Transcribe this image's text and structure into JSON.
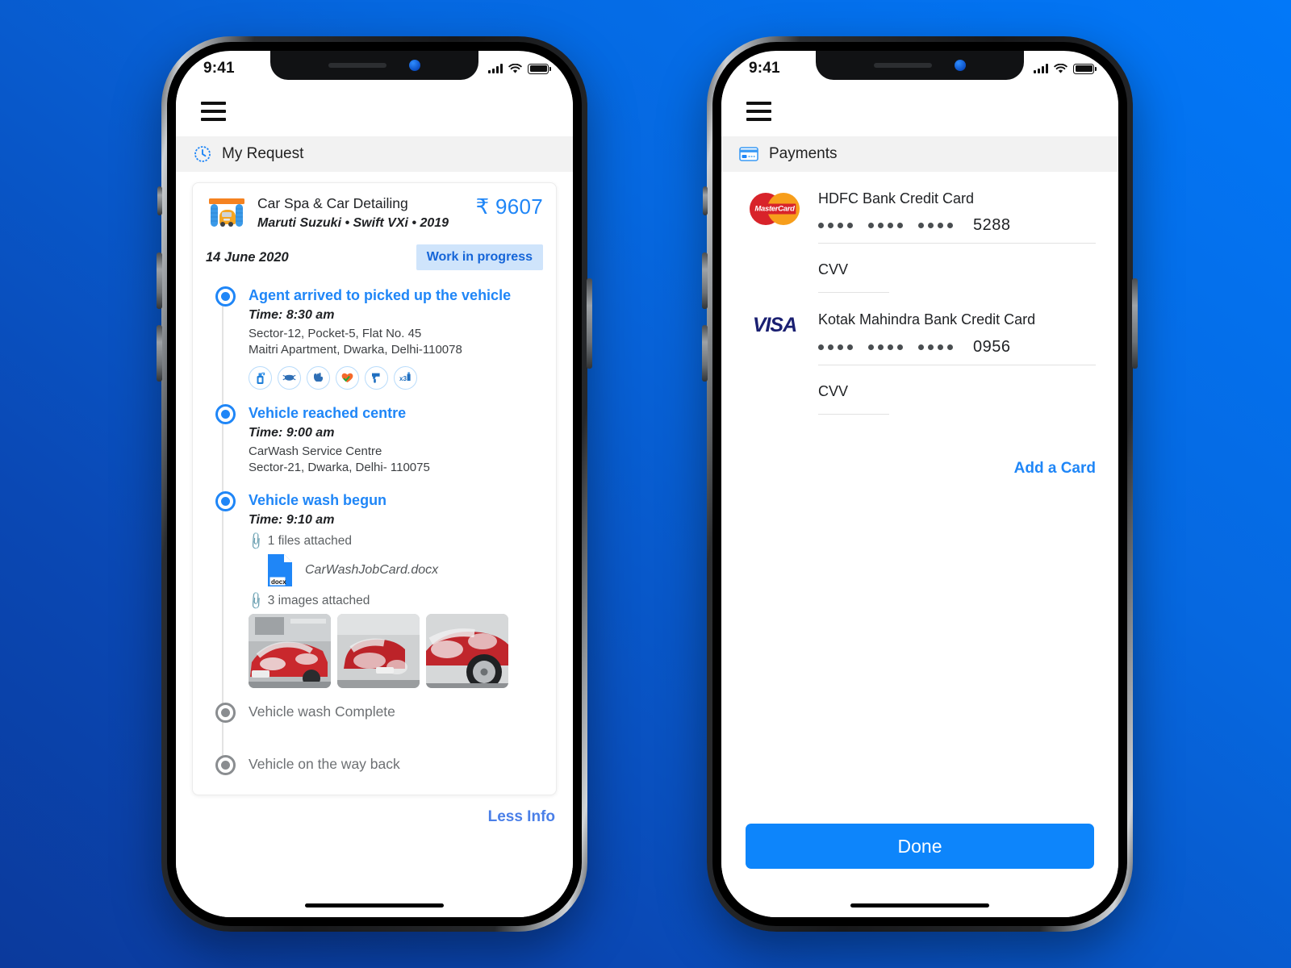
{
  "background": {
    "from": "#0278f8",
    "to": "#0b3a9c"
  },
  "accent": "#1f86f7",
  "phones": {
    "left": {
      "status": {
        "time": "9:41"
      },
      "nav": {
        "menu_icon": "hamburger-icon"
      },
      "section": {
        "icon": "clock-icon",
        "title": "My Request"
      },
      "card": {
        "service_icon": "car-wash-icon",
        "title": "Car Spa & Car Detailing",
        "vehicle": "Maruti Suzuki • Swift VXi • 2019",
        "price": "₹ 9607",
        "date": "14 June 2020",
        "status": "Work in progress"
      },
      "timeline": [
        {
          "state": "done",
          "title": "Agent arrived to picked up the vehicle",
          "time": "Time: 8:30 am",
          "address_line1": "Sector-12, Pocket-5, Flat No. 45",
          "address_line2": "Maitri Apartment, Dwarka, Delhi-110078",
          "safety_icons": [
            "sanitizer-icon",
            "mask-icon",
            "gloves-icon",
            "health-check-icon",
            "thermometer-gun-icon",
            "disinfect-x3-icon"
          ],
          "safety_glyphs": [
            "🧴",
            "😷",
            "🧤",
            "❤",
            "🔫",
            "🧪"
          ]
        },
        {
          "state": "done",
          "title": "Vehicle reached centre",
          "time": "Time: 9:00 am",
          "address_line1": "CarWash Service Centre",
          "address_line2": "Sector-21, Dwarka, Delhi- 110075"
        },
        {
          "state": "done",
          "title": "Vehicle wash begun",
          "time": "Time: 9:10 am",
          "files_label": "1 files attached",
          "file_name": "CarWashJobCard.docx",
          "file_type": "docx",
          "images_label": "3 images attached",
          "images": [
            "car-foam-front-left",
            "car-foam-rear",
            "car-foam-wheel"
          ]
        },
        {
          "state": "pending",
          "title": "Vehicle wash Complete"
        },
        {
          "state": "pending",
          "title": "Vehicle on the way back"
        }
      ],
      "less_info": "Less Info"
    },
    "right": {
      "status": {
        "time": "9:41"
      },
      "nav": {
        "menu_icon": "hamburger-icon"
      },
      "section": {
        "icon": "credit-card-icon",
        "title": "Payments"
      },
      "cards": [
        {
          "brand": "mastercard",
          "brand_label": "MasterCard",
          "name": "HDFC Bank Credit Card",
          "masked_groups": 3,
          "last4": "5288",
          "cvv_label": "CVV",
          "cvv_value": ""
        },
        {
          "brand": "visa",
          "brand_label": "VISA",
          "name": "Kotak Mahindra Bank Credit Card",
          "masked_groups": 3,
          "last4": "0956",
          "cvv_label": "CVV",
          "cvv_value": ""
        }
      ],
      "add_card": "Add a Card",
      "done_button": "Done"
    }
  }
}
